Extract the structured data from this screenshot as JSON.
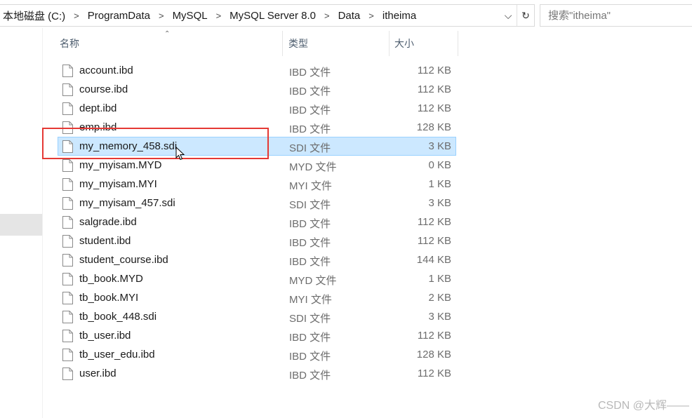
{
  "address_bar": {
    "crumbs": [
      "本地磁盘 (C:)",
      "ProgramData",
      "MySQL",
      "MySQL Server 8.0",
      "Data",
      "itheima"
    ],
    "separator": ">",
    "dropdown_glyph": "⌵",
    "refresh_glyph": "↻"
  },
  "search": {
    "placeholder": "搜索\"itheima\""
  },
  "columns": {
    "name": "名称",
    "type": "类型",
    "size": "大小",
    "sort_glyph": "⌃"
  },
  "files": [
    {
      "name": "account.ibd",
      "type": "IBD 文件",
      "size": "112 KB"
    },
    {
      "name": "course.ibd",
      "type": "IBD 文件",
      "size": "112 KB"
    },
    {
      "name": "dept.ibd",
      "type": "IBD 文件",
      "size": "112 KB"
    },
    {
      "name": "emp.ibd",
      "type": "IBD 文件",
      "size": "128 KB"
    },
    {
      "name": "my_memory_458.sdi",
      "type": "SDI 文件",
      "size": "3 KB",
      "selected": true
    },
    {
      "name": "my_myisam.MYD",
      "type": "MYD 文件",
      "size": "0 KB"
    },
    {
      "name": "my_myisam.MYI",
      "type": "MYI 文件",
      "size": "1 KB"
    },
    {
      "name": "my_myisam_457.sdi",
      "type": "SDI 文件",
      "size": "3 KB"
    },
    {
      "name": "salgrade.ibd",
      "type": "IBD 文件",
      "size": "112 KB"
    },
    {
      "name": "student.ibd",
      "type": "IBD 文件",
      "size": "112 KB"
    },
    {
      "name": "student_course.ibd",
      "type": "IBD 文件",
      "size": "144 KB"
    },
    {
      "name": "tb_book.MYD",
      "type": "MYD 文件",
      "size": "1 KB"
    },
    {
      "name": "tb_book.MYI",
      "type": "MYI 文件",
      "size": "2 KB"
    },
    {
      "name": "tb_book_448.sdi",
      "type": "SDI 文件",
      "size": "3 KB"
    },
    {
      "name": "tb_user.ibd",
      "type": "IBD 文件",
      "size": "112 KB"
    },
    {
      "name": "tb_user_edu.ibd",
      "type": "IBD 文件",
      "size": "128 KB"
    },
    {
      "name": "user.ibd",
      "type": "IBD 文件",
      "size": "112 KB"
    }
  ],
  "watermark": "CSDN @大辉——",
  "colors": {
    "selection_fill": "#cce8ff",
    "selection_border": "#99d1ff",
    "annotation": "#e53935",
    "header_text": "#4d5d6e",
    "secondary_text": "#6d6d6d"
  }
}
